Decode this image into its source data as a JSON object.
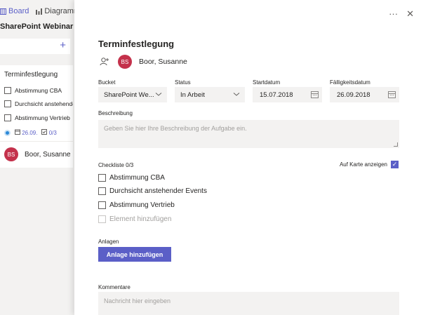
{
  "board": {
    "tabs": [
      {
        "label": "Board",
        "icon": "board-icon"
      },
      {
        "label": "Diagramme",
        "icon": "chart-icon"
      }
    ],
    "plan_name": "SharePoint Webinar",
    "add_button": "+",
    "card": {
      "title": "Terminfestlegung",
      "checklist": [
        "Abstimmung CBA",
        "Durchsicht anstehender",
        "Abstimmung Vertrieb"
      ],
      "due": "26.09.",
      "checklist_count": "0/3",
      "assignee_initials": "BS",
      "assignee_name": "Boor, Susanne"
    }
  },
  "panel": {
    "more_label": "···",
    "close_label": "✕",
    "title": "Terminfestlegung",
    "assignee_initials": "BS",
    "assignee_name": "Boor, Susanne",
    "fields": {
      "bucket": {
        "label": "Bucket",
        "value": "SharePoint We..."
      },
      "status": {
        "label": "Status",
        "value": "In Arbeit"
      },
      "start": {
        "label": "Startdatum",
        "value": "15.07.2018"
      },
      "due": {
        "label": "Fälligkeitsdatum",
        "value": "26.09.2018"
      }
    },
    "description": {
      "label": "Beschreibung",
      "placeholder": "Geben Sie hier Ihre Beschreibung der Aufgabe ein."
    },
    "checklist": {
      "label": "Checkliste 0/3",
      "show_on_card": "Auf Karte anzeigen",
      "items": [
        "Abstimmung CBA",
        "Durchsicht anstehender Events",
        "Abstimmung Vertrieb"
      ],
      "add_placeholder": "Element hinzufügen"
    },
    "attachments": {
      "label": "Anlagen",
      "button": "Anlage hinzufügen"
    },
    "comments": {
      "label": "Kommentare",
      "placeholder": "Nachricht hier eingeben"
    }
  },
  "colors": {
    "accent": "#5b5fc7",
    "avatar": "#c4314b",
    "field_bg": "#f3f2f1"
  }
}
